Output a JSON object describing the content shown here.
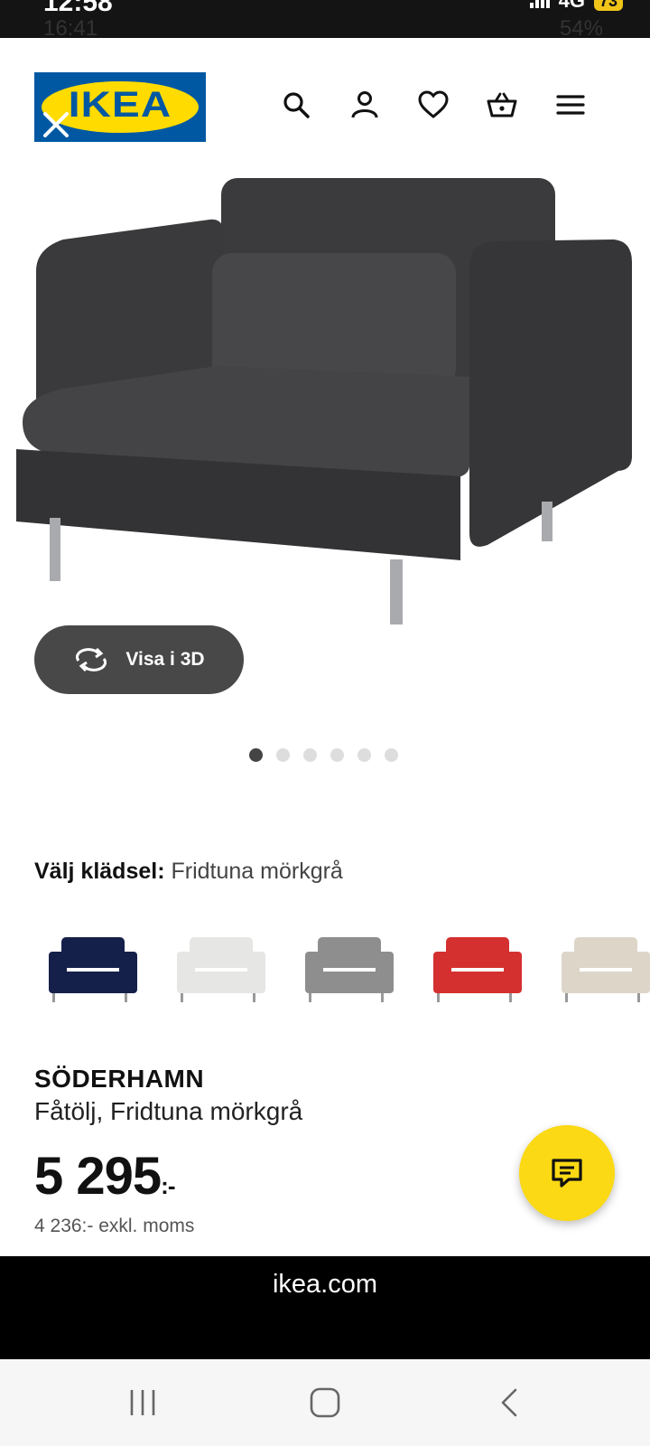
{
  "status_bar": {
    "outer_time": "12:58",
    "outer_network": "4G",
    "outer_battery": "73",
    "inner_time": "16:41",
    "inner_battery": "54%"
  },
  "header": {
    "logo_text": "IKEA",
    "icons": [
      "search-icon",
      "account-icon",
      "heart-icon",
      "basket-icon",
      "menu-icon"
    ]
  },
  "gallery": {
    "view_3d_label": "Visa i 3D",
    "image_count": 6,
    "active_index": 0
  },
  "upholstery": {
    "label": "Välj klädsel:",
    "selected": "Fridtuna mörkgrå",
    "swatch_colors": [
      "#15204a",
      "#e6e6e4",
      "#8e8e8e",
      "#d53030",
      "#ddd6c8"
    ]
  },
  "product": {
    "name": "SÖDERHAMN",
    "description": "Fåtölj, Fridtuna mörkgrå",
    "price": "5 295",
    "price_suffix": ":-",
    "price_ex_vat": "4 236:- exkl. moms"
  },
  "browser": {
    "url": "ikea.com"
  },
  "colors": {
    "ikea_blue": "#0058a3",
    "ikea_yellow": "#ffdb00",
    "chat_button": "#fbd914"
  }
}
